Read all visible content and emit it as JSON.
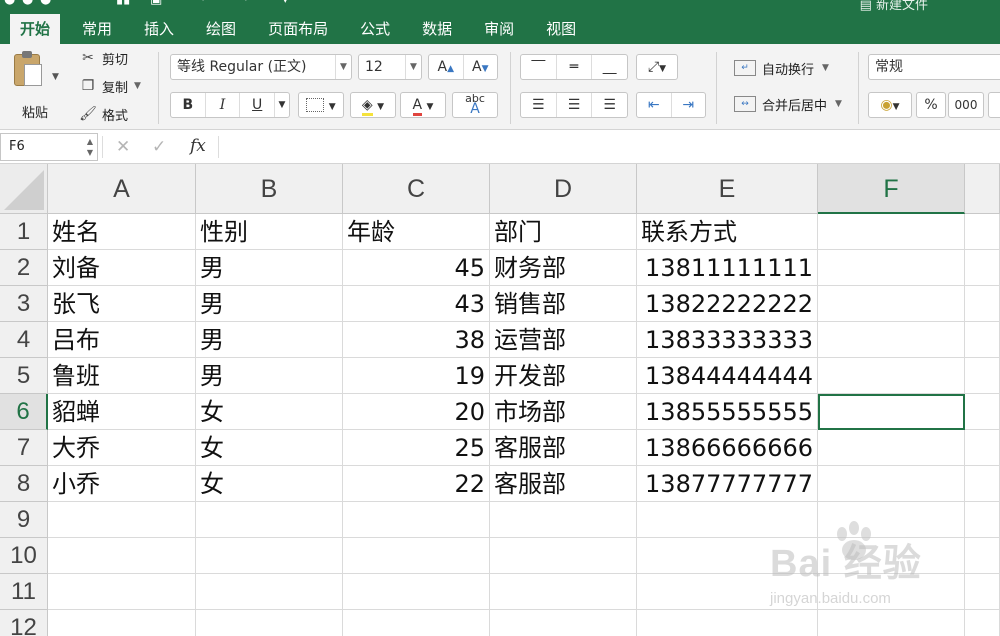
{
  "title_bar": {
    "doc_title": "新建文件"
  },
  "tabs": [
    {
      "label": "开始",
      "active": true
    },
    {
      "label": "常用",
      "active": false
    },
    {
      "label": "插入",
      "active": false
    },
    {
      "label": "绘图",
      "active": false
    },
    {
      "label": "页面布局",
      "active": false
    },
    {
      "label": "公式",
      "active": false
    },
    {
      "label": "数据",
      "active": false
    },
    {
      "label": "审阅",
      "active": false
    },
    {
      "label": "视图",
      "active": false
    }
  ],
  "ribbon": {
    "paste_label": "粘贴",
    "cut_label": "剪切",
    "copy_label": "复制",
    "format_label": "格式",
    "font_name": "等线 Regular (正文)",
    "font_size": "12",
    "grow_font": "A",
    "shrink_font": "A",
    "bold": "B",
    "italic": "I",
    "underline": "U",
    "font_color_letter": "A",
    "phonetic_label": "abc",
    "phonetic_letter": "A",
    "wrap_text_label": "自动换行",
    "merge_center_label": "合并后居中",
    "number_format": "常规",
    "percent": "%",
    "thousands": "000",
    "colors": {
      "accent": "#217346",
      "font_color_bar": "#e0443e",
      "highlight_bar": "#f5e23b"
    }
  },
  "formula_bar": {
    "name_box": "F6",
    "cancel_symbol": "✕",
    "enter_symbol": "✓",
    "fx_label": "fx",
    "content": ""
  },
  "sheet": {
    "active_cell": "F6",
    "columns": [
      "A",
      "B",
      "C",
      "D",
      "E",
      "F"
    ],
    "row_numbers": [
      "1",
      "2",
      "3",
      "4",
      "5",
      "6",
      "7",
      "8",
      "9",
      "10",
      "11",
      "12"
    ],
    "header": [
      "姓名",
      "性别",
      "年龄",
      "部门",
      "联系方式"
    ],
    "rows": [
      [
        "刘备",
        "男",
        "45",
        "财务部",
        "13811111111"
      ],
      [
        "张飞",
        "男",
        "43",
        "销售部",
        "13822222222"
      ],
      [
        "吕布",
        "男",
        "38",
        "运营部",
        "13833333333"
      ],
      [
        "鲁班",
        "男",
        "19",
        "开发部",
        "13844444444"
      ],
      [
        "貂蝉",
        "女",
        "20",
        "市场部",
        "13855555555"
      ],
      [
        "大乔",
        "女",
        "25",
        "客服部",
        "13866666666"
      ],
      [
        "小乔",
        "女",
        "22",
        "客服部",
        "13877777777"
      ]
    ]
  },
  "watermark": {
    "brand": "Bai 经验",
    "url": "jingyan.baidu.com"
  }
}
